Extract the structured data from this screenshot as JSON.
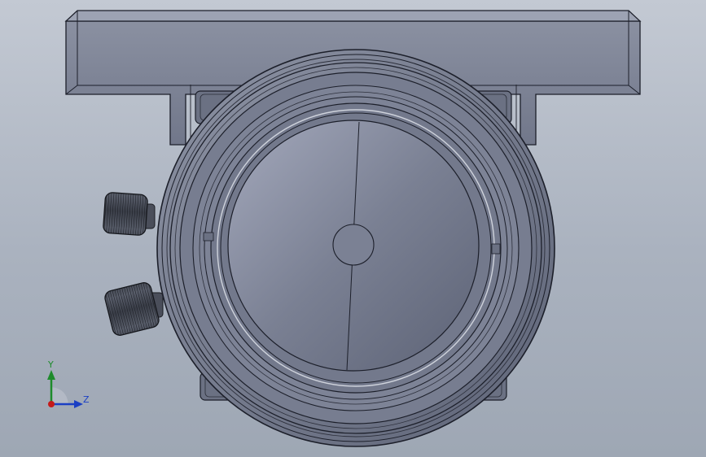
{
  "view": {
    "background_top": "#c3c9d3",
    "background_bottom": "#9ea7b4",
    "model_color": "#7a8092",
    "edge_color": "#1c1f2a",
    "glass_color": "#6d7489"
  },
  "triad": {
    "y_label": "Y",
    "z_label": "Z",
    "y_color": "#1e8b2b",
    "z_color": "#1b3fc4",
    "origin_color": "#c41a1a"
  }
}
